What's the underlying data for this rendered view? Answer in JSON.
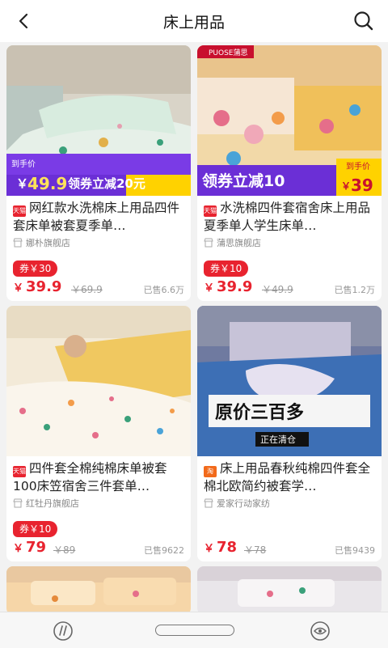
{
  "header": {
    "title": "床上用品"
  },
  "products": [
    {
      "title": "网红款水洗棉床上用品四件套床单被套夏季单…",
      "store": "娜朴旗舰店",
      "coupon": "券￥30",
      "price": "39.9",
      "orig": "￥69.9",
      "sold": "已售6.6万",
      "image_text": {
        "tag": "到手价",
        "price": "49.9",
        "promo": "领券立减20元"
      }
    },
    {
      "title": "水洗棉四件套宿舍床上用品夏季单人学生床单…",
      "store": "蒲思旗舰店",
      "coupon": "券￥10",
      "price": "39.9",
      "orig": "￥49.9",
      "sold": "已售1.2万",
      "image_text": {
        "brand": "PUOSE蒲思",
        "promo": "领券立减10",
        "tag": "到手价",
        "price": "39"
      }
    },
    {
      "title": "四件套全棉纯棉床单被套100床笠宿舍三件套单…",
      "store": "红牡丹旗舰店",
      "coupon": "券￥10",
      "price": "79",
      "orig": "￥89",
      "sold": "已售9622",
      "image_text": {}
    },
    {
      "title": "床上用品春秋纯棉四件套全棉北欧简约被套学…",
      "store": "爱家行动家纺",
      "coupon": "",
      "price": "78",
      "orig": "￥78",
      "sold": "已售9439",
      "image_text": {
        "main": "原价三百多",
        "sub": "正在清仓"
      }
    }
  ],
  "colors": {
    "accent": "#e8232f",
    "background": "#f2f2f2"
  },
  "icons": [
    "back-arrow-icon",
    "search-icon",
    "tmall-badge-icon",
    "taobao-badge-icon",
    "store-icon",
    "nav-back-icon",
    "nav-home-pill",
    "nav-assistant-icon"
  ]
}
